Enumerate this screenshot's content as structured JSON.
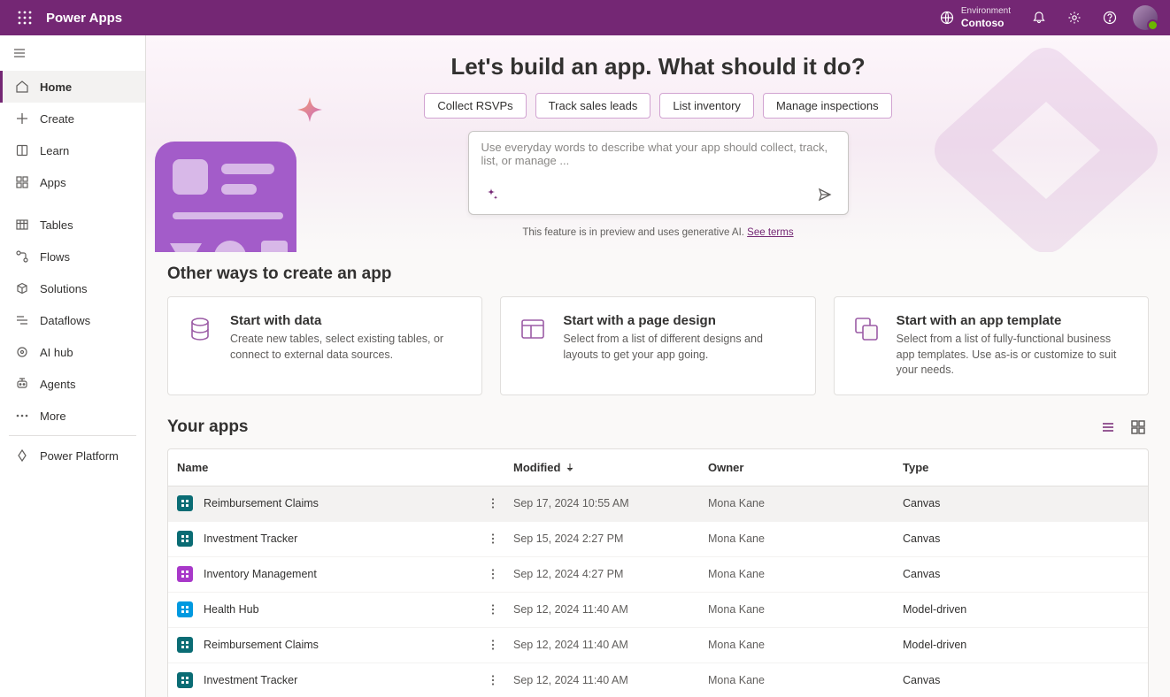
{
  "header": {
    "app_name": "Power Apps",
    "environment_label": "Environment",
    "environment_name": "Contoso"
  },
  "sidebar": {
    "items": [
      {
        "label": "Home"
      },
      {
        "label": "Create"
      },
      {
        "label": "Learn"
      },
      {
        "label": "Apps"
      },
      {
        "label": "Tables"
      },
      {
        "label": "Flows"
      },
      {
        "label": "Solutions"
      },
      {
        "label": "Dataflows"
      },
      {
        "label": "AI hub"
      },
      {
        "label": "Agents"
      },
      {
        "label": "More"
      },
      {
        "label": "Power Platform"
      }
    ]
  },
  "hero": {
    "title": "Let's build an app. What should it do?",
    "chips": [
      "Collect RSVPs",
      "Track sales leads",
      "List inventory",
      "Manage inspections"
    ],
    "placeholder": "Use everyday words to describe what your app should collect, track, list, or manage ...",
    "caption_prefix": "This feature is in preview and uses generative AI. ",
    "caption_link": "See terms"
  },
  "other_ways": {
    "title": "Other ways to create an app",
    "cards": [
      {
        "title": "Start with data",
        "desc": "Create new tables, select existing tables, or connect to external data sources."
      },
      {
        "title": "Start with a page design",
        "desc": "Select from a list of different designs and layouts to get your app going."
      },
      {
        "title": "Start with an app template",
        "desc": "Select from a list of fully-functional business app templates. Use as-is or customize to suit your needs."
      }
    ]
  },
  "apps": {
    "title": "Your apps",
    "columns": {
      "name": "Name",
      "modified": "Modified",
      "owner": "Owner",
      "type": "Type"
    },
    "rows": [
      {
        "name": "Reimbursement Claims",
        "modified": "Sep 17, 2024 10:55 AM",
        "owner": "Mona Kane",
        "type": "Canvas",
        "icon": "teal"
      },
      {
        "name": "Investment Tracker",
        "modified": "Sep 15, 2024 2:27 PM",
        "owner": "Mona Kane",
        "type": "Canvas",
        "icon": "teal"
      },
      {
        "name": "Inventory Management",
        "modified": "Sep 12, 2024 4:27 PM",
        "owner": "Mona Kane",
        "type": "Canvas",
        "icon": "purple"
      },
      {
        "name": "Health Hub",
        "modified": "Sep 12, 2024 11:40 AM",
        "owner": "Mona Kane",
        "type": "Model-driven",
        "icon": "blue"
      },
      {
        "name": "Reimbursement Claims",
        "modified": "Sep 12, 2024 11:40 AM",
        "owner": "Mona Kane",
        "type": "Model-driven",
        "icon": "teal"
      },
      {
        "name": "Investment Tracker",
        "modified": "Sep 12, 2024 11:40 AM",
        "owner": "Mona Kane",
        "type": "Canvas",
        "icon": "teal"
      }
    ]
  }
}
